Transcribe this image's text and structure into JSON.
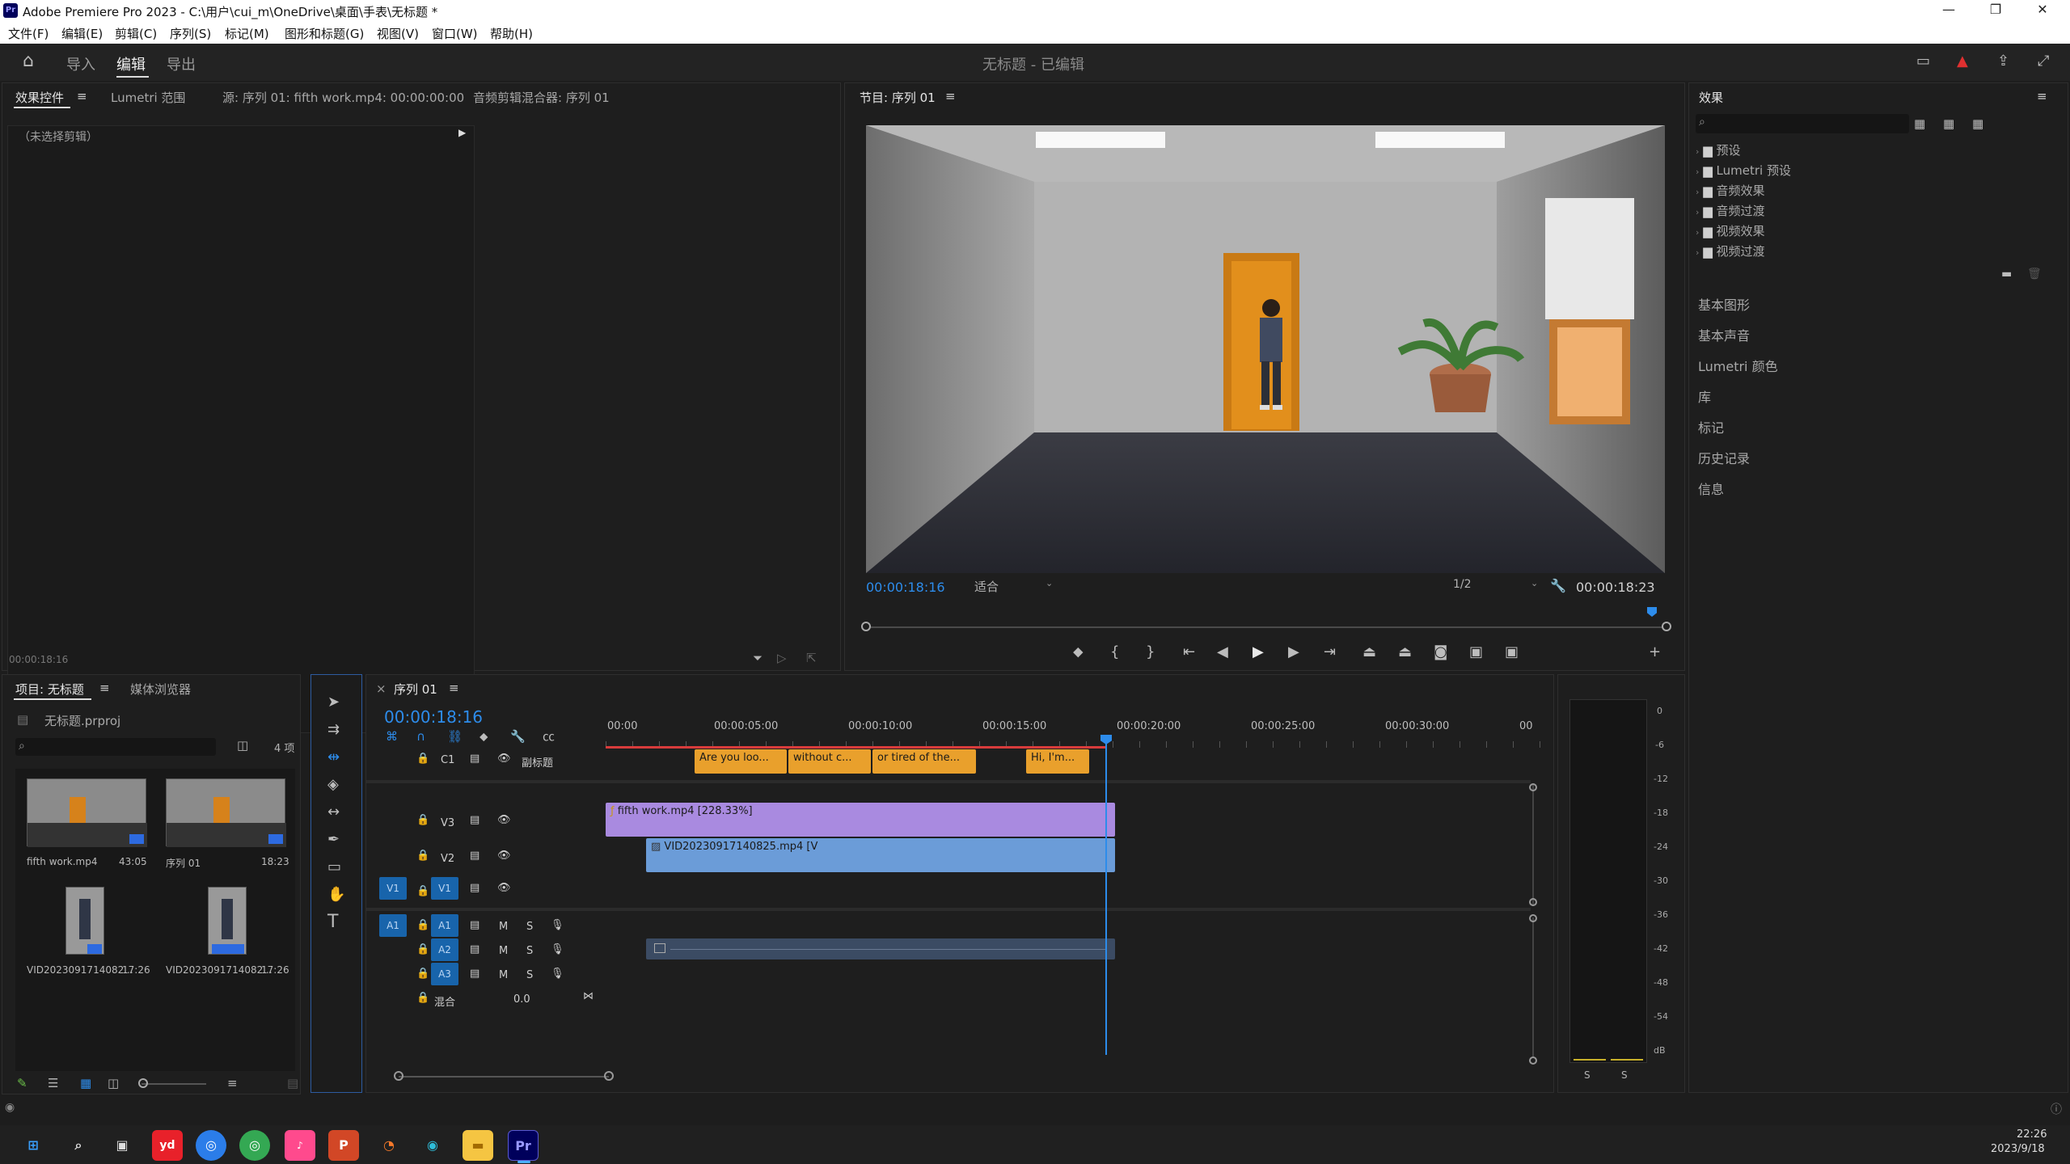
{
  "window": {
    "title": "Adobe Premiere Pro 2023 - C:\\用户\\cui_m\\OneDrive\\桌面\\手表\\无标题 *",
    "min": "—",
    "max": "❐",
    "close": "✕"
  },
  "menu": [
    "文件(F)",
    "编辑(E)",
    "剪辑(C)",
    "序列(S)",
    "标记(M)",
    "图形和标题(G)",
    "视图(V)",
    "窗口(W)",
    "帮助(H)"
  ],
  "workspace": {
    "tabs": [
      "导入",
      "编辑",
      "导出"
    ],
    "center": "无标题 - 已编辑"
  },
  "effect_controls": {
    "tabs": [
      "效果控件",
      "Lumetri 范围",
      "源: 序列 01: fifth work.mp4: 00:00:00:00",
      "音频剪辑混合器: 序列 01"
    ],
    "no_clip": "（未选择剪辑）",
    "timecode": "00:00:18:16"
  },
  "program": {
    "title": "节目: 序列 01",
    "timecode": "00:00:18:16",
    "fit": "适合",
    "quality": "1/2",
    "duration": "00:00:18:23"
  },
  "effects": {
    "title": "效果",
    "search_placeholder": "",
    "tree": [
      "预设",
      "Lumetri 预设",
      "音频效果",
      "音频过渡",
      "视频效果",
      "视频过渡"
    ],
    "sections": [
      "基本图形",
      "基本声音",
      "Lumetri 颜色",
      "库",
      "标记",
      "历史记录",
      "信息"
    ]
  },
  "project": {
    "tabs": [
      "项目: 无标题",
      "媒体浏览器"
    ],
    "file": "无标题.prproj",
    "count": "4 项",
    "items": [
      {
        "name": "fifth work.mp4",
        "dur": "43:05"
      },
      {
        "name": "序列 01",
        "dur": "18:23"
      },
      {
        "name": "VID2023091714082...",
        "dur": "17:26"
      },
      {
        "name": "VID2023091714082...",
        "dur": "17:26"
      }
    ]
  },
  "timeline": {
    "tab": "序列 01",
    "close": "×",
    "timecode": "00:00:18:16",
    "ruler": [
      "00:00",
      "00:00:05:00",
      "00:00:10:00",
      "00:00:15:00",
      "00:00:20:00",
      "00:00:25:00",
      "00:00:30:00",
      "00"
    ],
    "caption_track": "副标题",
    "captions": [
      "Are you loo...",
      "without c...",
      "or tired of the...",
      "Hi, I'm..."
    ],
    "tracks": {
      "c1": "C1",
      "v3": "V3",
      "v2": "V2",
      "v1": "V1",
      "a1": "A1",
      "a2": "A2",
      "a3": "A3",
      "mix": "混合",
      "mix_val": "0.0",
      "m": "M",
      "s": "S"
    },
    "clips": {
      "v3": "fifth work.mp4 [228.33%]",
      "v2": "VID20230917140825.mp4 [V"
    }
  },
  "meter": {
    "scale": [
      "0",
      "-6",
      "-12",
      "-18",
      "-24",
      "-30",
      "-36",
      "-42",
      "-48",
      "-54",
      "dB"
    ],
    "solo": [
      "S",
      "S"
    ]
  },
  "taskbar": {
    "time": "22:26",
    "date": "2023/9/18"
  }
}
